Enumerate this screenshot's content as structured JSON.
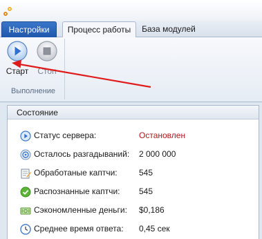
{
  "tabs": {
    "file_label": "Настройки",
    "items": [
      {
        "label": "Процесс работы"
      },
      {
        "label": "База модулей"
      }
    ]
  },
  "ribbon": {
    "group_label": "Выполнение",
    "start_label": "Старт",
    "stop_label": "Стоп"
  },
  "status": {
    "title": "Состояние",
    "rows": [
      {
        "label": "Статус сервера:",
        "value": "Остановлен",
        "icon": "server-status-icon"
      },
      {
        "label": "Осталось разгадываний:",
        "value": "2 000 000",
        "icon": "remaining-icon"
      },
      {
        "label": "Обработаные каптчи:",
        "value": "545",
        "icon": "processed-icon"
      },
      {
        "label": "Распознанные каптчи:",
        "value": "545",
        "icon": "recognized-icon"
      },
      {
        "label": "Сэкономленные деньги:",
        "value": "$0,186",
        "icon": "money-icon"
      },
      {
        "label": "Среднее время ответа:",
        "value": "0,45 сек",
        "icon": "clock-icon"
      }
    ]
  },
  "colors": {
    "accent": "#1f57ad",
    "stopped": "#b01818",
    "arrow": "#e01b1b"
  }
}
